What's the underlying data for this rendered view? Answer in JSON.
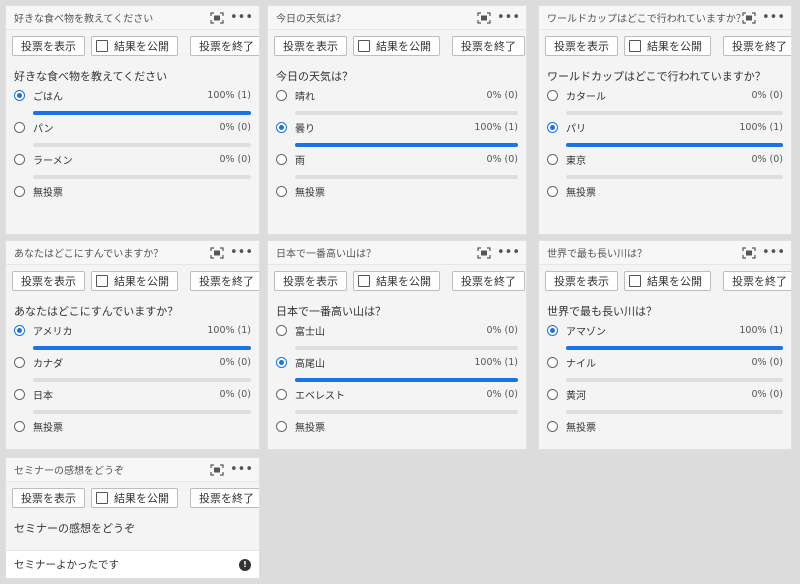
{
  "buttons": {
    "show": "投票を表示",
    "publish": "結果を公開",
    "end": "投票を終了"
  },
  "polls": [
    {
      "title": "好きな食べ物を教えてください",
      "question": "好きな食べ物を教えてください",
      "options": [
        {
          "label": "ごはん",
          "pct": "100% (1)",
          "fill": 1,
          "selected": true
        },
        {
          "label": "パン",
          "pct": "0% (0)",
          "fill": 0,
          "selected": false
        },
        {
          "label": "ラーメン",
          "pct": "0% (0)",
          "fill": 0,
          "selected": false
        }
      ],
      "abstain": "無投票"
    },
    {
      "title": "今日の天気は？",
      "question": "今日の天気は？",
      "options": [
        {
          "label": "晴れ",
          "pct": "0% (0)",
          "fill": 0,
          "selected": false
        },
        {
          "label": "曇り",
          "pct": "100% (1)",
          "fill": 1,
          "selected": true
        },
        {
          "label": "雨",
          "pct": "0% (0)",
          "fill": 0,
          "selected": false
        }
      ],
      "abstain": "無投票"
    },
    {
      "title": "ワールドカップはどこで行われていますか？",
      "question": "ワールドカップはどこで行われていますか？",
      "options": [
        {
          "label": "カタール",
          "pct": "0% (0)",
          "fill": 0,
          "selected": false
        },
        {
          "label": "パリ",
          "pct": "100% (1)",
          "fill": 1,
          "selected": true
        },
        {
          "label": "東京",
          "pct": "0% (0)",
          "fill": 0,
          "selected": false
        }
      ],
      "abstain": "無投票"
    },
    {
      "title": "あなたはどこにすんでいますか？",
      "question": "あなたはどこにすんでいますか？",
      "options": [
        {
          "label": "アメリカ",
          "pct": "100% (1)",
          "fill": 1,
          "selected": true
        },
        {
          "label": "カナダ",
          "pct": "0% (0)",
          "fill": 0,
          "selected": false
        },
        {
          "label": "日本",
          "pct": "0% (0)",
          "fill": 0,
          "selected": false
        }
      ],
      "abstain": "無投票"
    },
    {
      "title": "日本で一番高い山は？",
      "question": "日本で一番高い山は？",
      "options": [
        {
          "label": "富士山",
          "pct": "0% (0)",
          "fill": 0,
          "selected": false
        },
        {
          "label": "高尾山",
          "pct": "100% (1)",
          "fill": 1,
          "selected": true
        },
        {
          "label": "エベレスト",
          "pct": "0% (0)",
          "fill": 0,
          "selected": false
        }
      ],
      "abstain": "無投票"
    },
    {
      "title": "世界で最も長い川は？",
      "question": "世界で最も長い川は？",
      "options": [
        {
          "label": "アマゾン",
          "pct": "100% (1)",
          "fill": 1,
          "selected": true
        },
        {
          "label": "ナイル",
          "pct": "0% (0)",
          "fill": 0,
          "selected": false
        },
        {
          "label": "黄河",
          "pct": "0% (0)",
          "fill": 0,
          "selected": false
        }
      ],
      "abstain": "無投票"
    }
  ],
  "freeform": {
    "title": "セミナーの感想をどうぞ",
    "question": "セミナーの感想をどうぞ",
    "input_value": "セミナーよかったです"
  },
  "icons": {
    "expand": "expand-icon",
    "more": "more-icon",
    "info": "info-icon"
  },
  "colors": {
    "accent": "#1a73e8",
    "card_bg": "#f4f4f4",
    "page_bg": "#dcdcdc"
  }
}
